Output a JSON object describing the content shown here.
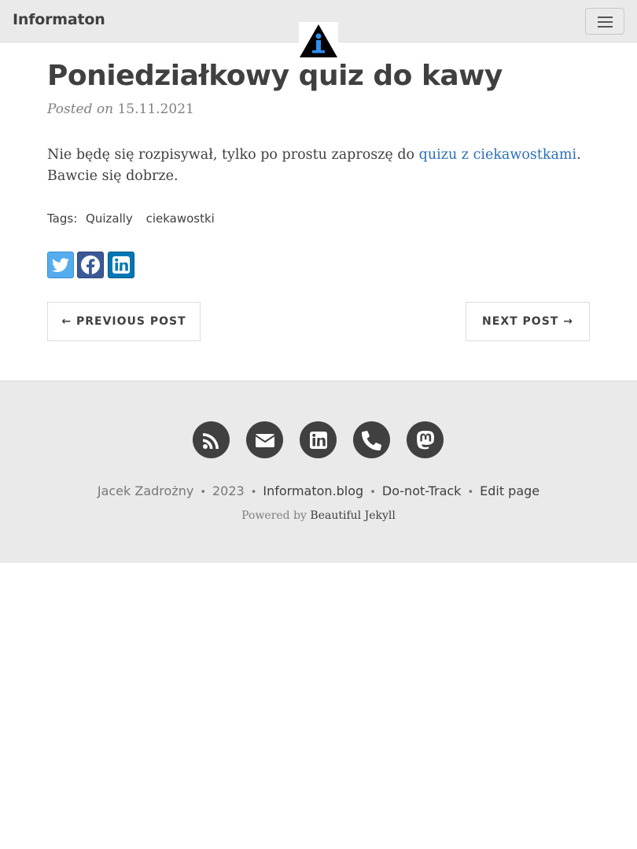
{
  "navbar": {
    "brand": "Informaton",
    "logo_icon": "info-triangle-icon",
    "menu_icon": "hamburger-icon"
  },
  "post": {
    "title": "Poniedziałkowy quiz do kawy",
    "posted_prefix": "Posted on",
    "date": "15.11.2021",
    "body_before": "Nie będę się rozpisywał, tylko po prostu zaproszę do ",
    "body_link": "quizu z ciekawostkami",
    "body_after": ". Bawcie się dobrze.",
    "tags_label": "Tags:",
    "tags": [
      "Quizally",
      "ciekawostki"
    ]
  },
  "share": [
    "twitter-icon",
    "facebook-icon",
    "linkedin-icon"
  ],
  "pager": {
    "previous": "← PREVIOUS POST",
    "next": "NEXT POST →"
  },
  "footer": {
    "social_icons": [
      "rss-icon",
      "envelope-icon",
      "linkedin-icon",
      "phone-icon",
      "mastodon-icon"
    ],
    "author": "Jacek Zadrożny",
    "year": "2023",
    "site": "Informaton.blog",
    "dnt": "Do-not-Track",
    "edit": "Edit page",
    "powered_prefix": "Powered by",
    "powered_link": "Beautiful Jekyll",
    "separator": "•"
  },
  "colors": {
    "twitter": "#55acee",
    "facebook": "#3b5998",
    "linkedin": "#0077b5",
    "link": "#2a6fb8"
  }
}
